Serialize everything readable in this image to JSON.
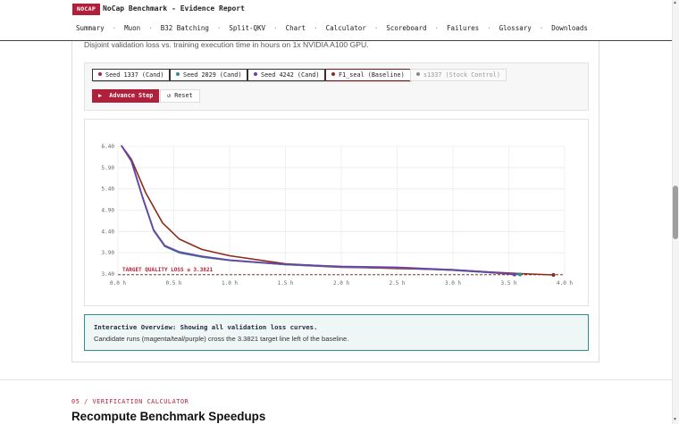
{
  "header": {
    "badge": "NOCAP",
    "title": "NoCap Benchmark - Evidence Report",
    "nav": [
      "Summary",
      "Muon",
      "B32 Batching",
      "Split-QKV",
      "Chart",
      "Calculator",
      "Scoreboard",
      "Failures",
      "Glossary",
      "Downloads"
    ]
  },
  "card": {
    "subtitle": "Disjoint validation loss vs. training execution time in hours on 1x NVIDIA A100 GPU."
  },
  "runs": [
    {
      "label": "Seed 1337 (Cand)",
      "color": "#b0203a",
      "state": "on"
    },
    {
      "label": "Seed 2029 (Cand)",
      "color": "#2f8f8f",
      "state": "on"
    },
    {
      "label": "Seed 4242 (Cand)",
      "color": "#6a3fb0",
      "state": "on"
    },
    {
      "label": "F1_seal (Baseline)",
      "color": "#8a2c1c",
      "state": "on"
    },
    {
      "label": "s1337 (Stock Control)",
      "color": "#888888",
      "state": "off"
    }
  ],
  "buttons": {
    "advance": "Advance Step",
    "reset": "Reset"
  },
  "icons": {
    "advance": "play-icon",
    "reset": "undo-icon"
  },
  "chart_data": {
    "type": "line",
    "title": "",
    "xlabel": "",
    "ylabel": "",
    "xlim": [
      0,
      4.0
    ],
    "ylim": [
      3.4,
      6.4
    ],
    "x_ticks": [
      "0.0 h",
      "0.5 h",
      "1.0 h",
      "1.5 h",
      "2.0 h",
      "2.5 h",
      "3.0 h",
      "3.5 h",
      "4.0 h"
    ],
    "y_ticks": [
      "6.40",
      "5.90",
      "5.40",
      "4.90",
      "4.40",
      "3.90",
      "3.40"
    ],
    "target": {
      "label": "TARGET QUALITY LOSS ≤ 3.3821",
      "value": 3.3821
    },
    "grid": true,
    "series": [
      {
        "color": "#b0203a",
        "x": [
          0.03,
          0.12,
          0.22,
          0.32,
          0.42,
          0.55,
          0.75,
          1.0,
          1.5,
          2.0,
          2.5,
          3.0,
          3.3,
          3.5,
          3.55
        ],
        "y": [
          6.42,
          6.05,
          5.2,
          4.42,
          4.05,
          3.9,
          3.8,
          3.72,
          3.62,
          3.56,
          3.54,
          3.49,
          3.44,
          3.4,
          3.39
        ]
      },
      {
        "color": "#2f8f8f",
        "x": [
          0.03,
          0.12,
          0.22,
          0.32,
          0.42,
          0.55,
          0.75,
          1.0,
          1.5,
          2.0,
          2.5,
          3.0,
          3.3,
          3.5,
          3.6
        ],
        "y": [
          6.42,
          6.05,
          5.2,
          4.42,
          4.05,
          3.9,
          3.8,
          3.72,
          3.62,
          3.57,
          3.55,
          3.49,
          3.44,
          3.41,
          3.39
        ]
      },
      {
        "color": "#6a3fb0",
        "x": [
          0.03,
          0.12,
          0.22,
          0.32,
          0.42,
          0.55,
          0.75,
          1.0,
          1.5,
          2.0,
          2.5,
          3.0,
          3.3,
          3.5,
          3.55
        ],
        "y": [
          6.42,
          6.07,
          5.22,
          4.44,
          4.07,
          3.92,
          3.82,
          3.73,
          3.63,
          3.58,
          3.56,
          3.5,
          3.45,
          3.41,
          3.39
        ]
      },
      {
        "color": "#8a2c1c",
        "x": [
          0.03,
          0.12,
          0.25,
          0.4,
          0.55,
          0.75,
          1.0,
          1.5,
          2.0,
          2.5,
          3.0,
          3.3,
          3.6,
          3.8,
          3.9
        ],
        "y": [
          6.42,
          6.1,
          5.3,
          4.6,
          4.22,
          3.98,
          3.83,
          3.64,
          3.57,
          3.53,
          3.5,
          3.45,
          3.41,
          3.39,
          3.38
        ]
      }
    ]
  },
  "overview": {
    "title": "Interactive Overview: Showing all validation loss curves.",
    "text": "Candidate runs (magenta/teal/purple) cross the 3.3821 target line left of the baseline."
  },
  "next_section": {
    "label": "05 / VERIFICATION CALCULATOR",
    "title": "Recompute Benchmark Speedups"
  }
}
